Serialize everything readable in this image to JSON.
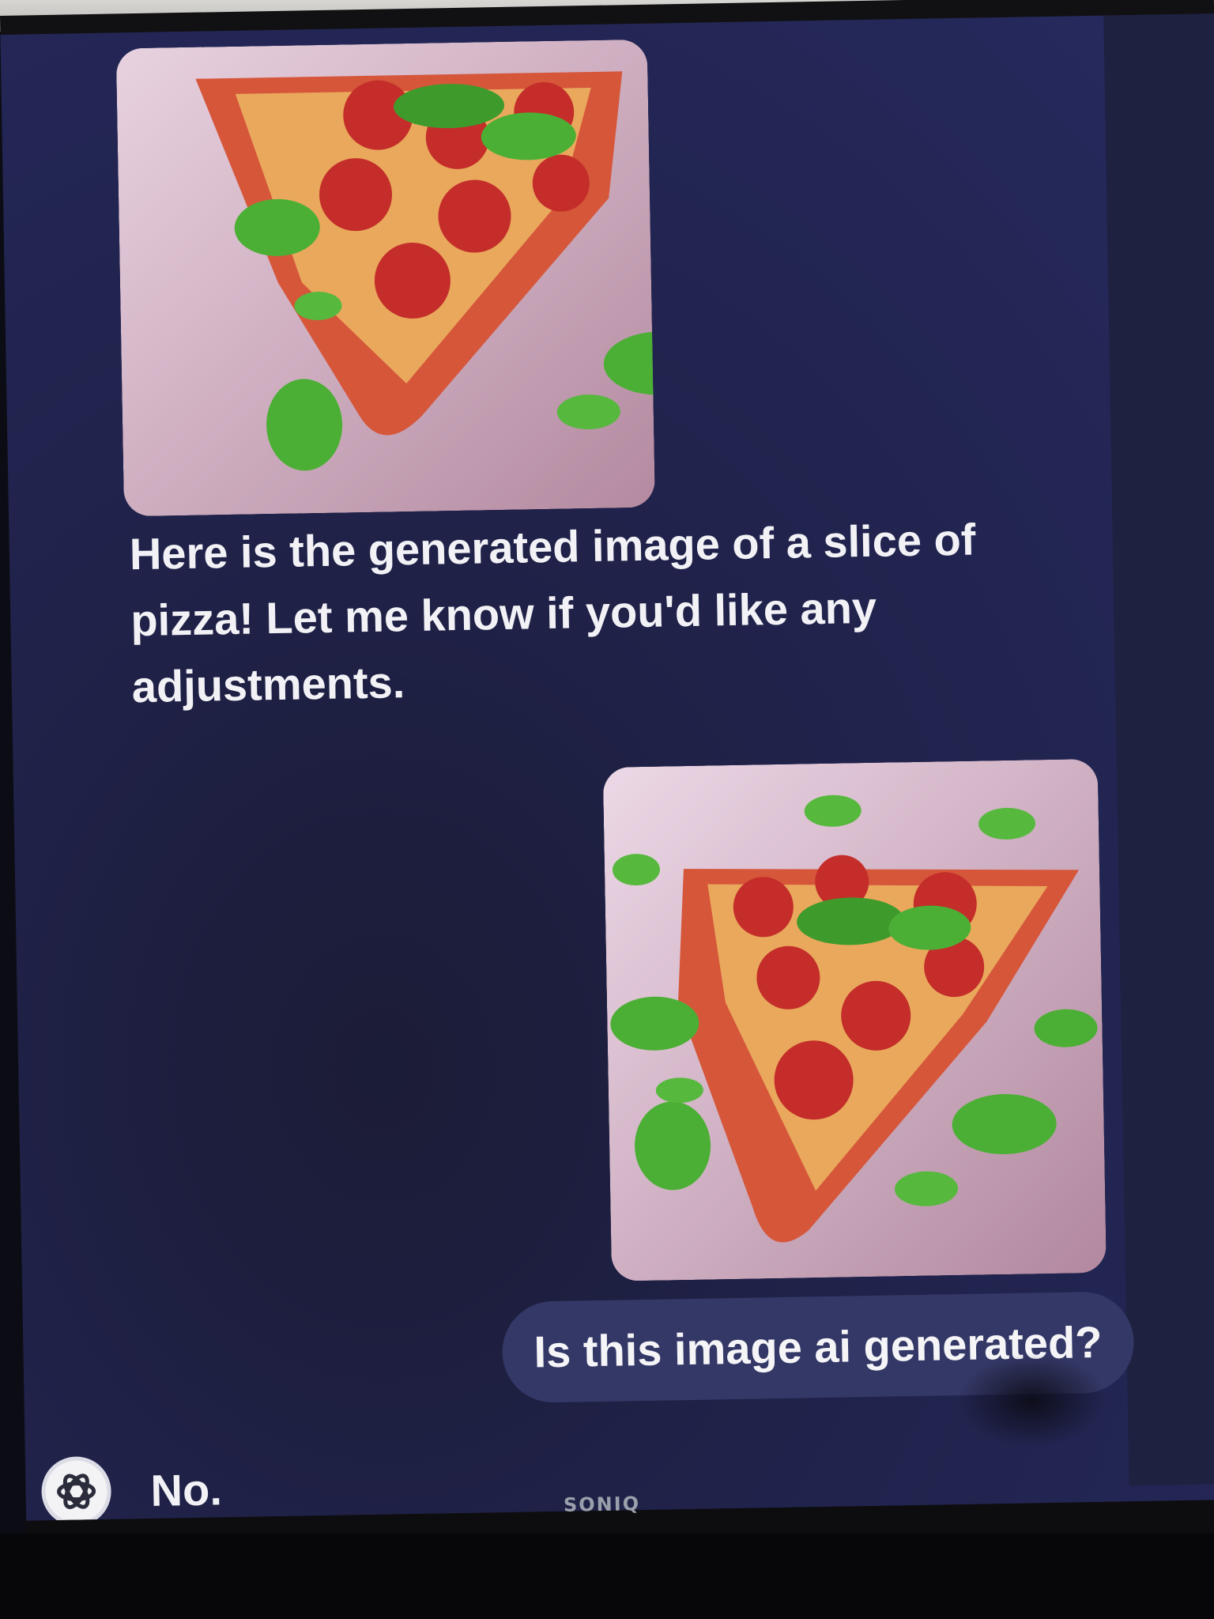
{
  "chat": {
    "assistant_message": "Here is the generated image of a slice of pizza! Let me know if you'd like any adjustments.",
    "user_message": "Is this image ai generated?",
    "assistant_reply": "No."
  },
  "monitor": {
    "brand": "SONIQ"
  },
  "icons": {
    "assistant_avatar": "openai-logo-icon"
  },
  "colors": {
    "screen_background": "#23264f",
    "user_bubble": "#343866",
    "text": "#f2f2f6"
  }
}
